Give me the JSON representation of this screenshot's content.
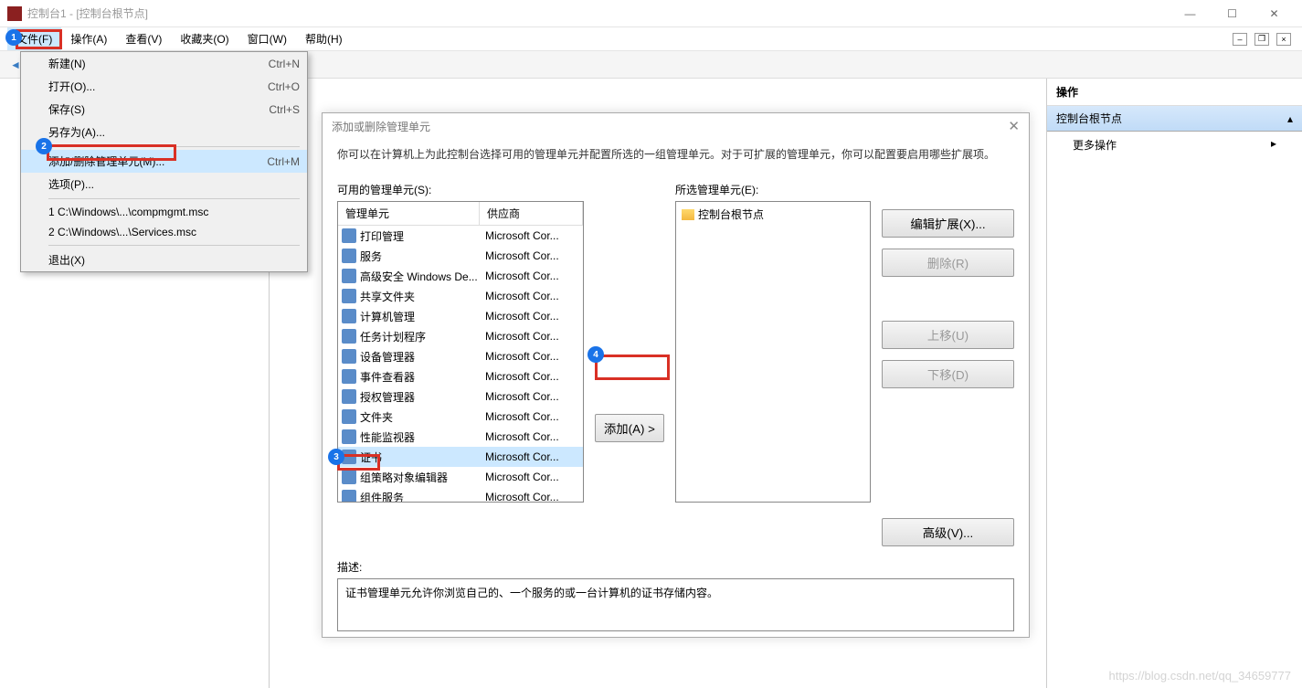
{
  "window": {
    "title": "控制台1 - [控制台根节点]"
  },
  "menubar": {
    "items": [
      {
        "label": "文件(F)",
        "active": true
      },
      {
        "label": "操作(A)"
      },
      {
        "label": "查看(V)"
      },
      {
        "label": "收藏夹(O)"
      },
      {
        "label": "窗口(W)"
      },
      {
        "label": "帮助(H)"
      }
    ]
  },
  "file_menu": {
    "items": [
      {
        "label": "新建(N)",
        "shortcut": "Ctrl+N"
      },
      {
        "label": "打开(O)...",
        "shortcut": "Ctrl+O"
      },
      {
        "label": "保存(S)",
        "shortcut": "Ctrl+S"
      },
      {
        "label": "另存为(A)..."
      }
    ],
    "items2": [
      {
        "label": "添加/删除管理单元(M)...",
        "shortcut": "Ctrl+M",
        "hover": true
      },
      {
        "label": "选项(P)..."
      }
    ],
    "items3": [
      {
        "label": "1 C:\\Windows\\...\\compmgmt.msc"
      },
      {
        "label": "2 C:\\Windows\\...\\Services.msc"
      }
    ],
    "items4": [
      {
        "label": "退出(X)"
      }
    ]
  },
  "actions": {
    "header": "操作",
    "section": "控制台根节点",
    "more": "更多操作"
  },
  "dialog": {
    "title": "添加或删除管理单元",
    "desc": "你可以在计算机上为此控制台选择可用的管理单元并配置所选的一组管理单元。对于可扩展的管理单元，你可以配置要启用哪些扩展项。",
    "avail_label": "可用的管理单元(S):",
    "selected_label": "所选管理单元(E):",
    "headers": {
      "snapin": "管理单元",
      "vendor": "供应商"
    },
    "snapins": [
      {
        "name": "打印管理",
        "vendor": "Microsoft Cor..."
      },
      {
        "name": "服务",
        "vendor": "Microsoft Cor..."
      },
      {
        "name": "高级安全 Windows De...",
        "vendor": "Microsoft Cor..."
      },
      {
        "name": "共享文件夹",
        "vendor": "Microsoft Cor..."
      },
      {
        "name": "计算机管理",
        "vendor": "Microsoft Cor..."
      },
      {
        "name": "任务计划程序",
        "vendor": "Microsoft Cor..."
      },
      {
        "name": "设备管理器",
        "vendor": "Microsoft Cor..."
      },
      {
        "name": "事件查看器",
        "vendor": "Microsoft Cor..."
      },
      {
        "name": "授权管理器",
        "vendor": "Microsoft Cor..."
      },
      {
        "name": "文件夹",
        "vendor": "Microsoft Cor..."
      },
      {
        "name": "性能监视器",
        "vendor": "Microsoft Cor..."
      },
      {
        "name": "证书",
        "vendor": "Microsoft Cor...",
        "selected": true
      },
      {
        "name": "组策略对象编辑器",
        "vendor": "Microsoft Cor..."
      },
      {
        "name": "组件服务",
        "vendor": "Microsoft Cor..."
      }
    ],
    "selected_root": "控制台根节点",
    "buttons": {
      "add": "添加(A) >",
      "edit_ext": "编辑扩展(X)...",
      "remove": "删除(R)",
      "move_up": "上移(U)",
      "move_down": "下移(D)",
      "advanced": "高级(V)..."
    },
    "desc_label": "描述:",
    "desc_text": "证书管理单元允许你浏览自己的、一个服务的或一台计算机的证书存储内容。"
  },
  "watermark": "https://blog.csdn.net/qq_34659777"
}
